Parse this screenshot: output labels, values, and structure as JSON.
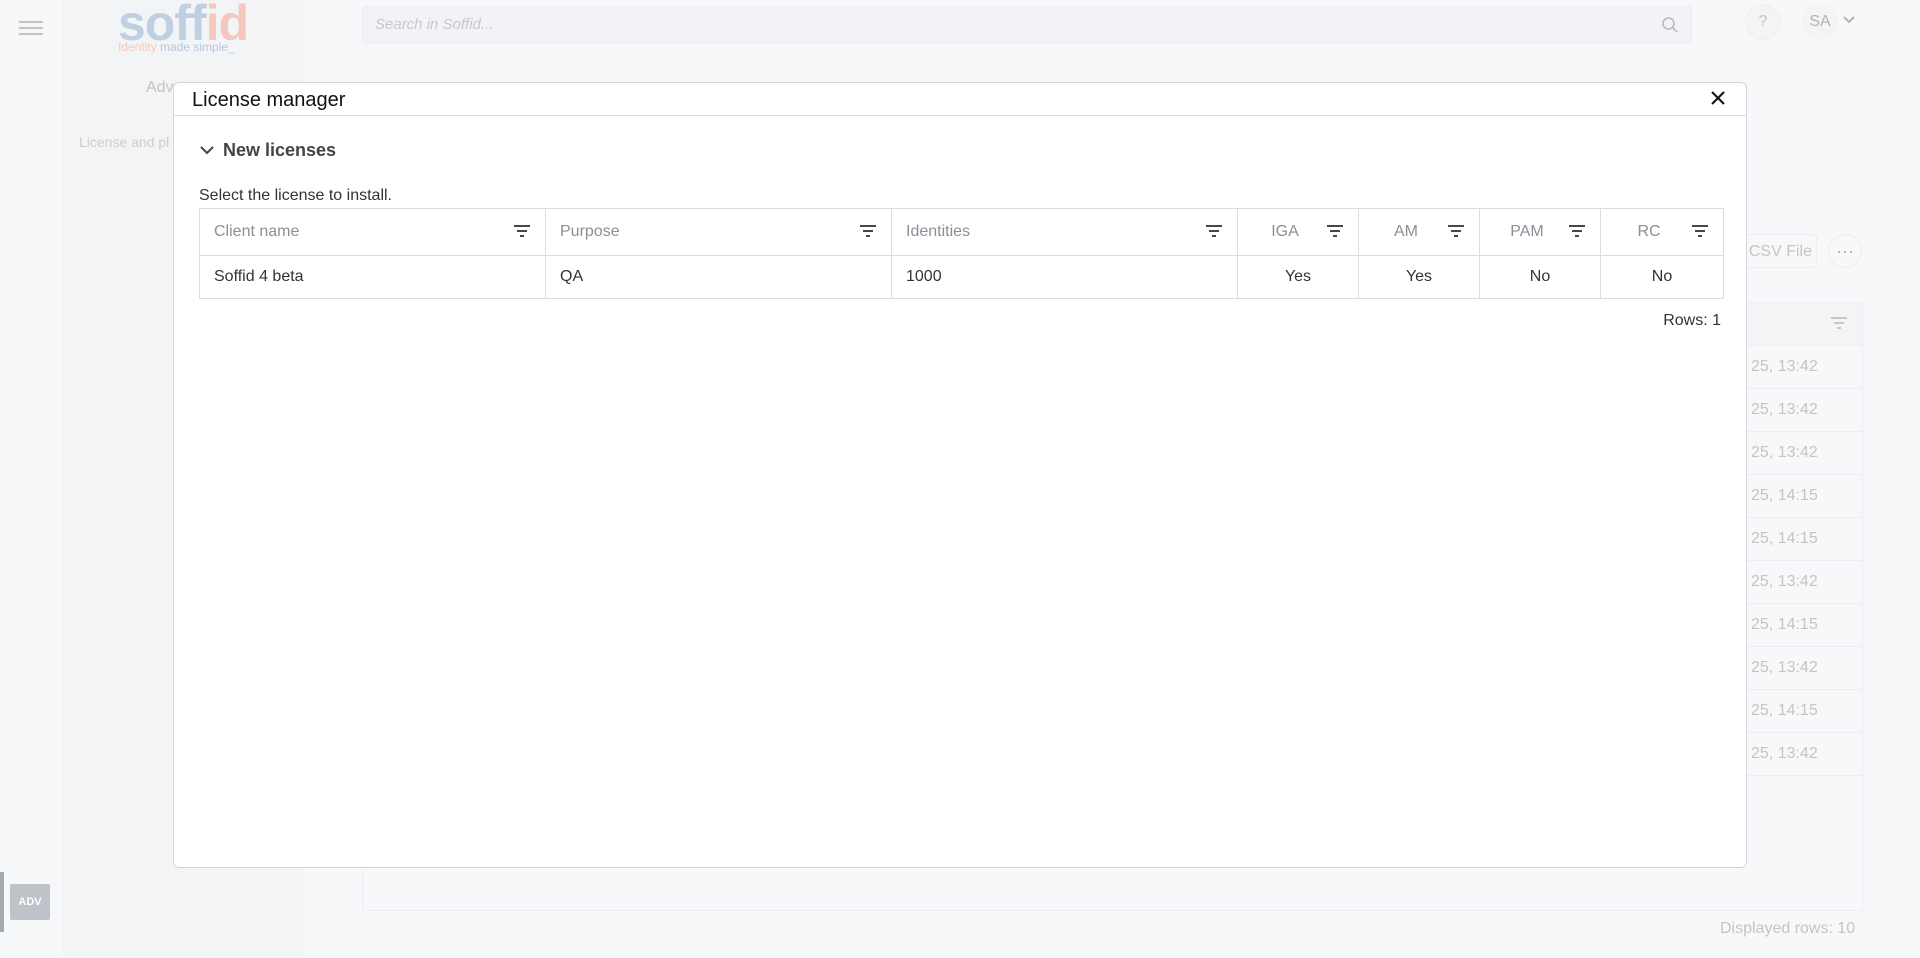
{
  "app": {
    "logo_text_main": "soff",
    "logo_text_accent": "id",
    "logo_tagline_a": "Identity",
    "logo_tagline_b": "made simple_",
    "badge": "ADV"
  },
  "subnav": {
    "title": "Adv",
    "item": "License and pl"
  },
  "topbar": {
    "search_placeholder": "Search in Soffid...",
    "help": "?",
    "user_initials": "SA"
  },
  "background_page": {
    "csv_button": "CSV File",
    "more_button": "···",
    "rows": [
      "25, 13:42",
      "25, 13:42",
      "25, 13:42",
      "25, 14:15",
      "25, 14:15",
      "25, 13:42",
      "25, 14:15",
      "25, 13:42",
      "25, 14:15",
      "25, 13:42"
    ],
    "displayed_rows": "Displayed rows: 10"
  },
  "dialog": {
    "title": "License manager",
    "section_title": "New licenses",
    "instruction": "Select the license to install.",
    "columns": [
      "Client name",
      "Purpose",
      "Identities",
      "IGA",
      "AM",
      "PAM",
      "RC"
    ],
    "rows": [
      [
        "Soffid 4 beta",
        "QA",
        "1000",
        "Yes",
        "Yes",
        "No",
        "No"
      ]
    ],
    "rows_count": "Rows: 1"
  },
  "colors": {
    "logo_blue": "#7da0c4",
    "logo_coral": "#e8917c",
    "badge_bg": "#7f8590"
  }
}
